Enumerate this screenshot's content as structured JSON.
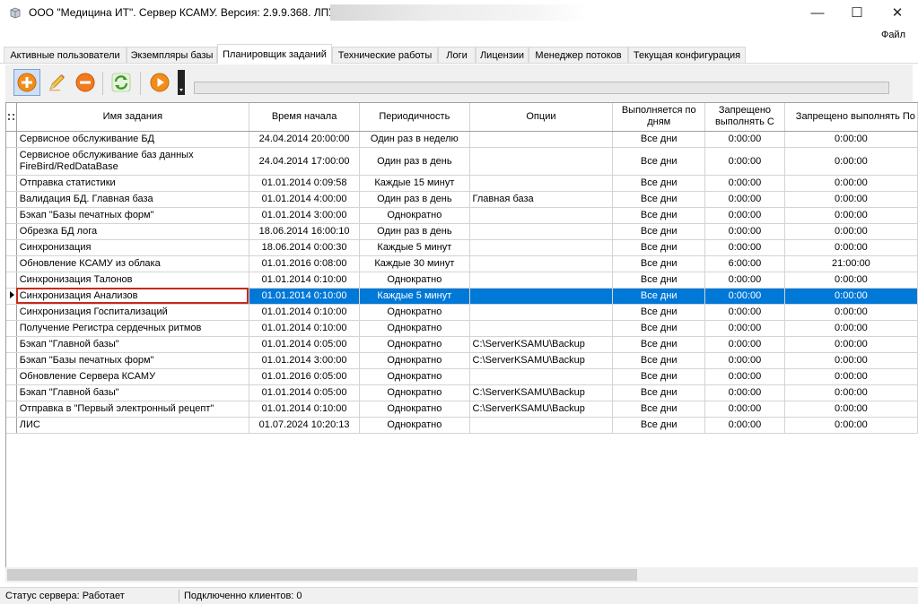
{
  "window": {
    "title": "ООО \"Медицина ИТ\". Сервер КСАМУ. Версия: 2.9.9.368. ЛПУ:",
    "minimize": "—",
    "maximize": "☐",
    "close": "✕"
  },
  "menu": {
    "file": "Файл"
  },
  "tabs": [
    {
      "label": "Активные пользователи",
      "active": false
    },
    {
      "label": "Экземпляры базы",
      "active": false
    },
    {
      "label": "Планировщик заданий",
      "active": true
    },
    {
      "label": "Технические работы",
      "active": false
    },
    {
      "label": "Логи",
      "active": false
    },
    {
      "label": "Лицензии",
      "active": false
    },
    {
      "label": "Менеджер потоков",
      "active": false
    },
    {
      "label": "Текущая конфигурация",
      "active": false
    }
  ],
  "toolbar": {
    "buttons": [
      "add-icon",
      "edit-icon",
      "remove-icon",
      "refresh-icon",
      "run-icon"
    ],
    "progress": 0
  },
  "grid": {
    "columns": [
      "Имя задания",
      "Время начала",
      "Периодичность",
      "Опции",
      "Выполняется по дням",
      "Запрещено выполнять С",
      "Запрещено выполнять По"
    ],
    "rows": [
      {
        "name": "Сервисное обслуживание БД",
        "start": "24.04.2014 20:00:00",
        "period": "Один раз в неделю",
        "options": "",
        "days": "Все дни",
        "from": "0:00:00",
        "to": "0:00:00"
      },
      {
        "name": "Сервисное обслуживание баз данных FireBird/RedDataBase",
        "start": "24.04.2014 17:00:00",
        "period": "Один раз в день",
        "options": "",
        "days": "Все дни",
        "from": "0:00:00",
        "to": "0:00:00",
        "tall": true
      },
      {
        "name": "Отправка статистики",
        "start": "01.01.2014 0:09:58",
        "period": "Каждые 15 минут",
        "options": "",
        "days": "Все дни",
        "from": "0:00:00",
        "to": "0:00:00"
      },
      {
        "name": "Валидация БД. Главная база",
        "start": "01.01.2014 4:00:00",
        "period": "Один раз в день",
        "options": "Главная база",
        "days": "Все дни",
        "from": "0:00:00",
        "to": "0:00:00"
      },
      {
        "name": "Бэкап \"Базы печатных форм\"",
        "start": "01.01.2014 3:00:00",
        "period": "Однократно",
        "options": "",
        "days": "Все дни",
        "from": "0:00:00",
        "to": "0:00:00"
      },
      {
        "name": "Обрезка БД лога",
        "start": "18.06.2014 16:00:10",
        "period": "Один раз в день",
        "options": "",
        "days": "Все дни",
        "from": "0:00:00",
        "to": "0:00:00"
      },
      {
        "name": "Синхронизация",
        "start": "18.06.2014 0:00:30",
        "period": "Каждые 5 минут",
        "options": "",
        "days": "Все дни",
        "from": "0:00:00",
        "to": "0:00:00"
      },
      {
        "name": "Обновление КСАМУ из облака",
        "start": "01.01.2016 0:08:00",
        "period": "Каждые 30 минут",
        "options": "",
        "days": "Все дни",
        "from": "6:00:00",
        "to": "21:00:00"
      },
      {
        "name": "Синхронизация Талонов",
        "start": "01.01.2014 0:10:00",
        "period": "Однократно",
        "options": "",
        "days": "Все дни",
        "from": "0:00:00",
        "to": "0:00:00"
      },
      {
        "name": "Синхронизация Анализов",
        "start": "01.01.2014 0:10:00",
        "period": "Каждые 5 минут",
        "options": "",
        "days": "Все дни",
        "from": "0:00:00",
        "to": "0:00:00",
        "selected": true
      },
      {
        "name": "Синхронизация Госпитализаций",
        "start": "01.01.2014 0:10:00",
        "period": "Однократно",
        "options": "",
        "days": "Все дни",
        "from": "0:00:00",
        "to": "0:00:00"
      },
      {
        "name": "Получение Регистра сердечных ритмов",
        "start": "01.01.2014 0:10:00",
        "period": "Однократно",
        "options": "",
        "days": "Все дни",
        "from": "0:00:00",
        "to": "0:00:00"
      },
      {
        "name": "Бэкап \"Главной базы\"",
        "start": "01.01.2014 0:05:00",
        "period": "Однократно",
        "options": "C:\\ServerKSAMU\\Backup",
        "days": "Все дни",
        "from": "0:00:00",
        "to": "0:00:00"
      },
      {
        "name": "Бэкап \"Базы печатных форм\"",
        "start": "01.01.2014 3:00:00",
        "period": "Однократно",
        "options": "C:\\ServerKSAMU\\Backup",
        "days": "Все дни",
        "from": "0:00:00",
        "to": "0:00:00"
      },
      {
        "name": "Обновление Сервера КСАМУ",
        "start": "01.01.2016 0:05:00",
        "period": "Однократно",
        "options": "",
        "days": "Все дни",
        "from": "0:00:00",
        "to": "0:00:00"
      },
      {
        "name": "Бэкап \"Главной базы\"",
        "start": "01.01.2014 0:05:00",
        "period": "Однократно",
        "options": "C:\\ServerKSAMU\\Backup",
        "days": "Все дни",
        "from": "0:00:00",
        "to": "0:00:00"
      },
      {
        "name": "Отправка в \"Первый электронный рецепт\"",
        "start": "01.01.2014 0:10:00",
        "period": "Однократно",
        "options": "C:\\ServerKSAMU\\Backup",
        "days": "Все дни",
        "from": "0:00:00",
        "to": "0:00:00"
      },
      {
        "name": "ЛИС",
        "start": "01.07.2024 10:20:13",
        "period": "Однократно",
        "options": "",
        "days": "Все дни",
        "from": "0:00:00",
        "to": "0:00:00"
      }
    ]
  },
  "status": {
    "server": "Статус сервера: Работает",
    "clients": "Подключенно клиентов: 0"
  },
  "colors": {
    "selection": "#0078d7",
    "focus_outline": "#c42b1c"
  }
}
